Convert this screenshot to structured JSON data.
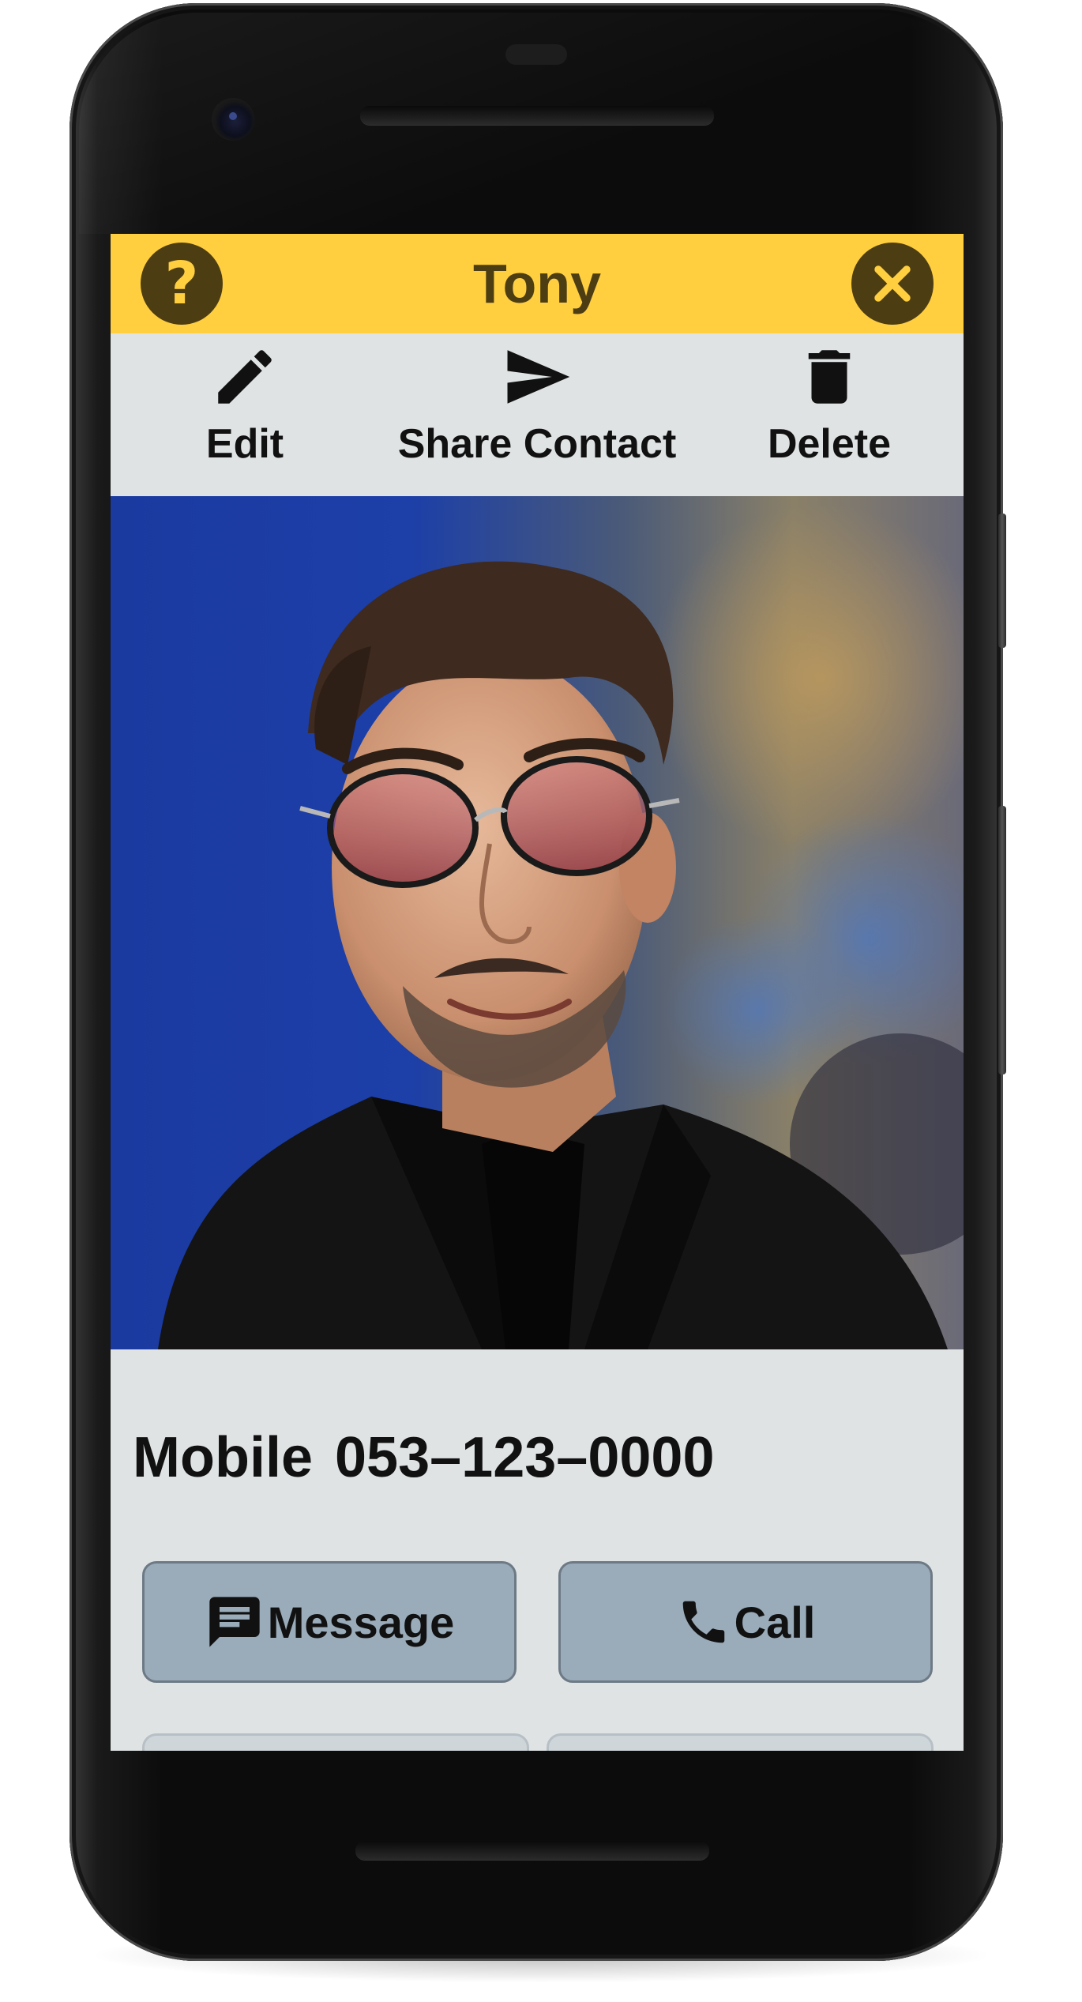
{
  "header": {
    "title": "Tony",
    "help_icon": "help-circle-icon",
    "close_icon": "close-circle-icon"
  },
  "toolbar": {
    "edit_label": "Edit",
    "share_label": "Share Contact",
    "delete_label": "Delete"
  },
  "contact": {
    "phone_type": "Mobile",
    "phone_number": "053–123–0000",
    "photo_icon": "contact-photo"
  },
  "actions": {
    "message_label": "Message",
    "call_label": "Call"
  },
  "colors": {
    "header_bg": "#ffcf40",
    "header_fg": "#4d3d13",
    "screen_bg": "#dfe3e4",
    "button_bg": "#9aabb9"
  }
}
